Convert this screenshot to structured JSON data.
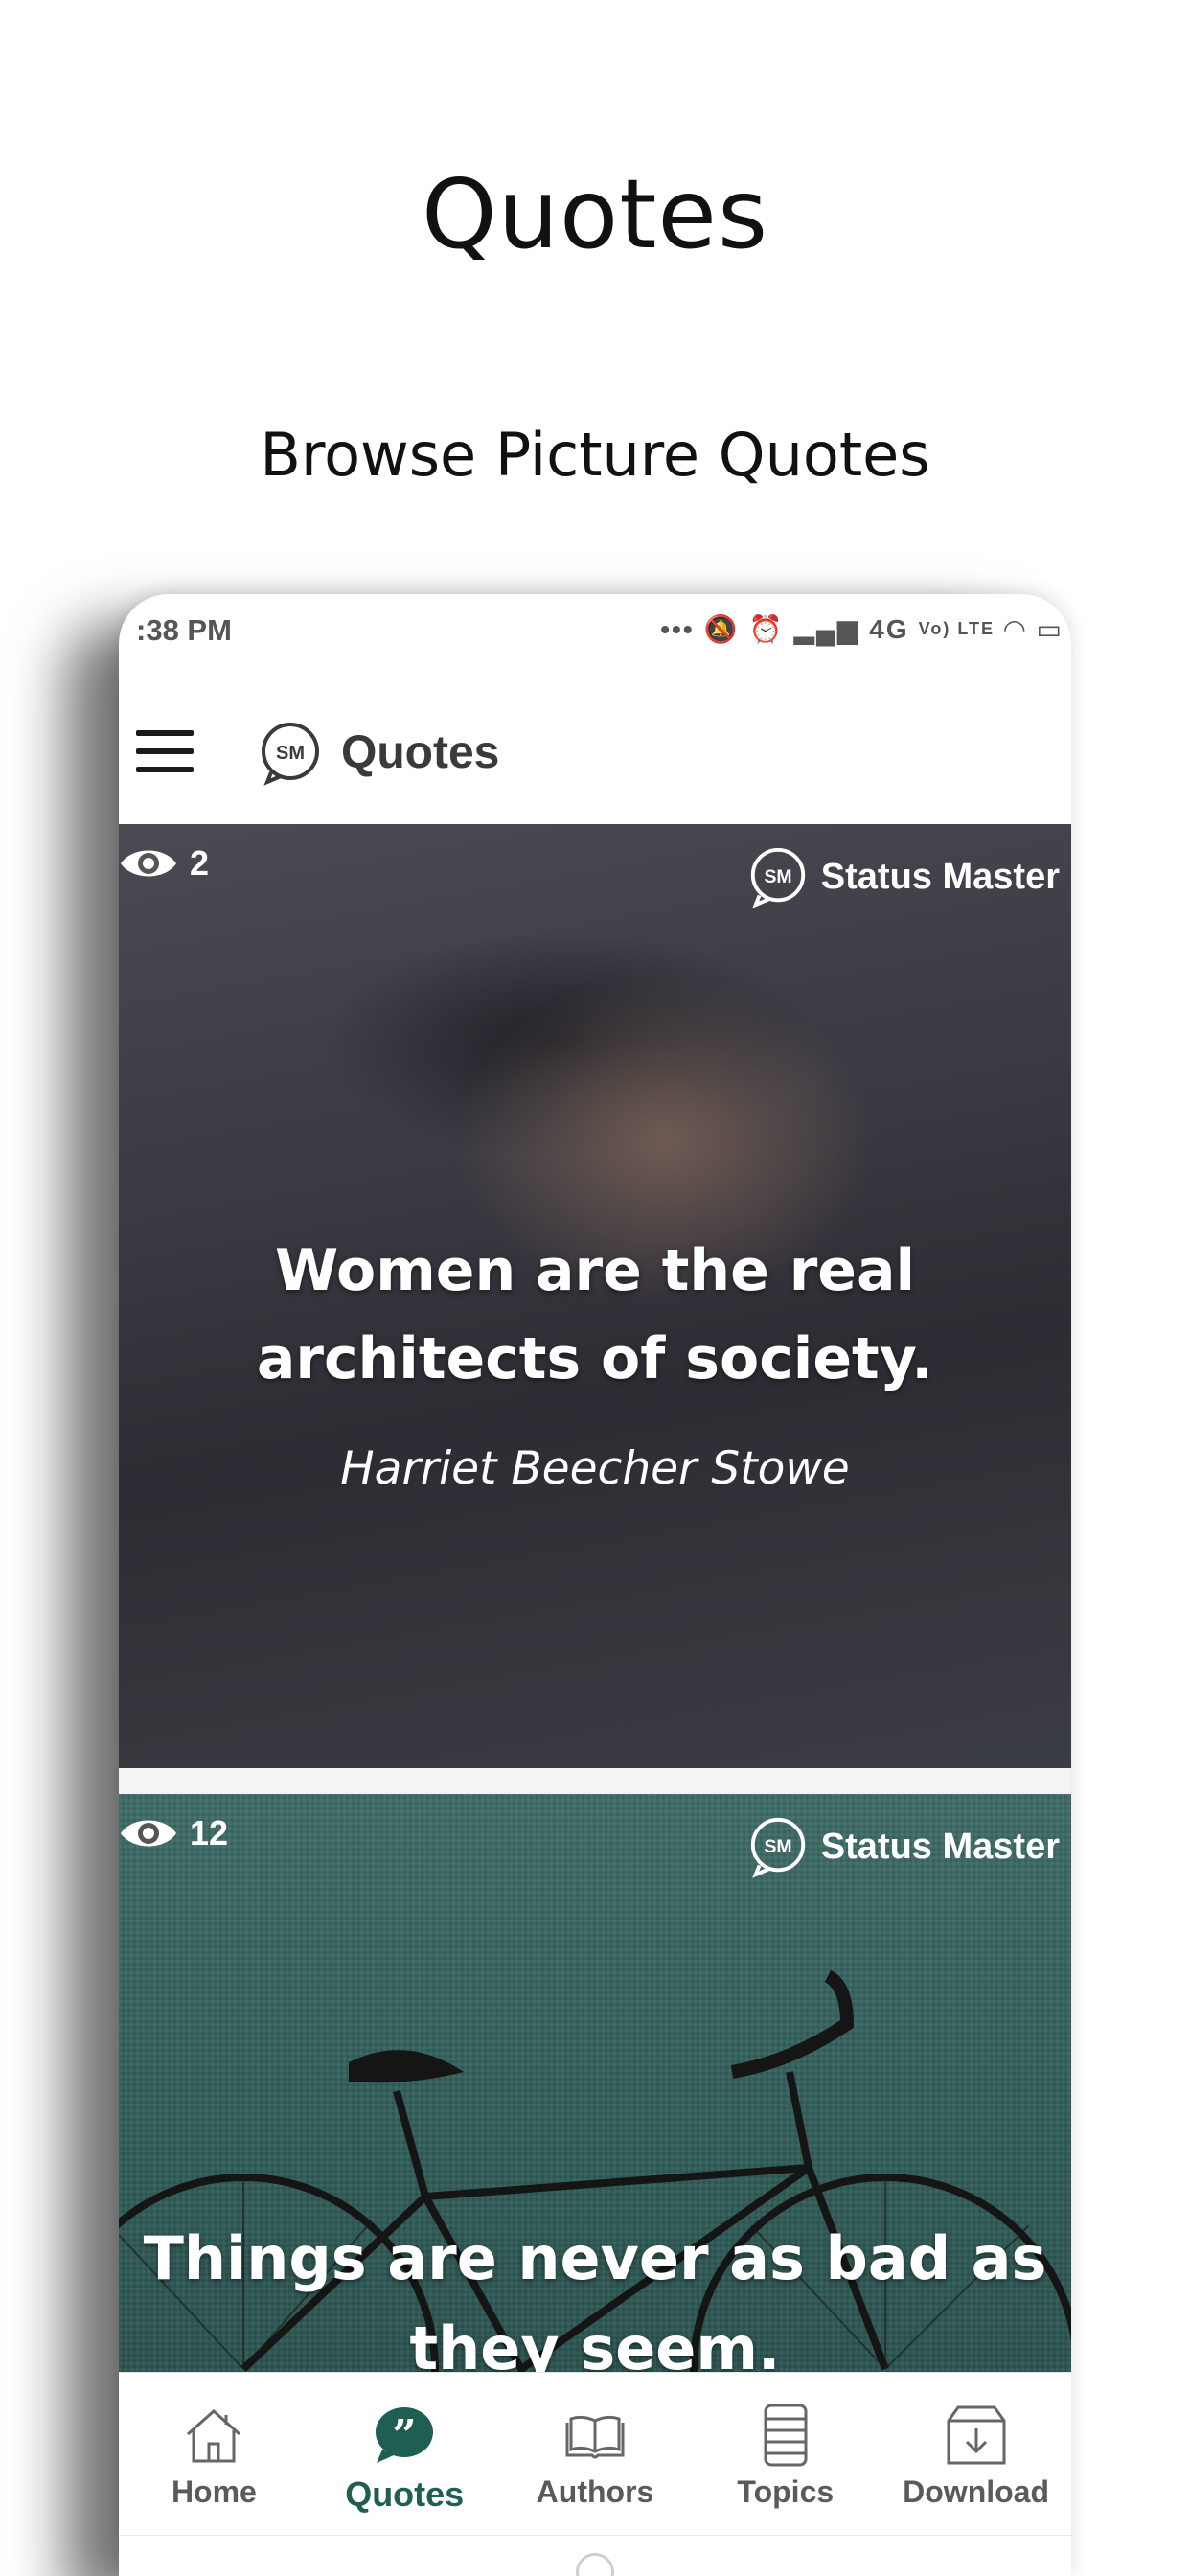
{
  "promo": {
    "title": "Quotes",
    "subtitle": "Browse Picture Quotes"
  },
  "status_bar": {
    "time": ":38 PM",
    "network": "4G",
    "volte": "Vo) LTE"
  },
  "app_bar": {
    "title": "Quotes",
    "logo_text": "SM"
  },
  "feed": [
    {
      "views": "2",
      "watermark": "Status Master",
      "quote_line1": "Women are the real",
      "quote_line2": "architects of society.",
      "author": "Harriet Beecher Stowe"
    },
    {
      "views": "12",
      "watermark": "Status Master",
      "quote_line1": "Things are never as bad as",
      "quote_line2": "they seem."
    }
  ],
  "bottom_nav": {
    "items": [
      {
        "label": "Home",
        "icon": "home-icon"
      },
      {
        "label": "Quotes",
        "icon": "quotes-icon",
        "active": true
      },
      {
        "label": "Authors",
        "icon": "book-icon"
      },
      {
        "label": "Topics",
        "icon": "topics-icon"
      },
      {
        "label": "Download",
        "icon": "download-box-icon"
      }
    ]
  },
  "colors": {
    "accent": "#1f5e52",
    "nav_inactive": "#5a5a5a"
  }
}
